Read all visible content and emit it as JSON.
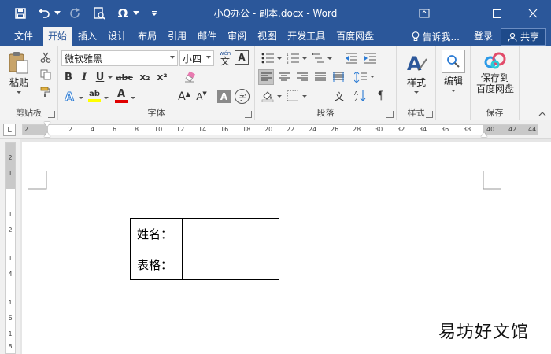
{
  "titlebar": {
    "title": "小Q办公 - 副本.docx - Word",
    "bg": "#2b579a"
  },
  "tabs": [
    {
      "label": "文件"
    },
    {
      "label": "开始"
    },
    {
      "label": "插入"
    },
    {
      "label": "设计"
    },
    {
      "label": "布局"
    },
    {
      "label": "引用"
    },
    {
      "label": "邮件"
    },
    {
      "label": "审阅"
    },
    {
      "label": "视图"
    },
    {
      "label": "开发工具"
    },
    {
      "label": "百度网盘"
    }
  ],
  "tell_me": "告诉我...",
  "login": "登录",
  "share": "共享",
  "ribbon": {
    "clipboard": {
      "paste": "粘贴",
      "label": "剪贴板"
    },
    "font": {
      "name": "微软雅黑",
      "size": "小四",
      "label": "字体",
      "wen_glyph": "wén",
      "wen_char": "文",
      "char_border": "A",
      "bold": "B",
      "italic": "I",
      "underline": "U",
      "strike": "abc",
      "sub": "x₂",
      "sup": "x²",
      "effects": "A",
      "highlight": "ab",
      "color": "A",
      "grow": "A",
      "shrink": "A",
      "shade": "A",
      "phonetic": "字"
    },
    "paragraph": {
      "label": "段落"
    },
    "styles": {
      "btn": "样式",
      "label": "样式"
    },
    "editing": {
      "btn": "编辑"
    },
    "save": {
      "btn_line1": "保存到",
      "btn_line2": "百度网盘",
      "label": "保存"
    }
  },
  "ruler": {
    "corner": "L",
    "ticks": [
      "2",
      "2",
      "4",
      "6",
      "8",
      "10",
      "12",
      "14",
      "16",
      "18",
      "20",
      "22",
      "24",
      "26",
      "28",
      "30",
      "32",
      "34",
      "36",
      "38",
      "40",
      "42",
      "44"
    ]
  },
  "vruler": {
    "ticks": [
      "2",
      "1",
      "1",
      "2",
      "1",
      "4",
      "1",
      "6",
      "1",
      "8"
    ]
  },
  "document": {
    "rows": [
      {
        "label": "姓名：",
        "value": ""
      },
      {
        "label": "表格：",
        "value": ""
      }
    ]
  },
  "watermark": "易坊好文馆"
}
